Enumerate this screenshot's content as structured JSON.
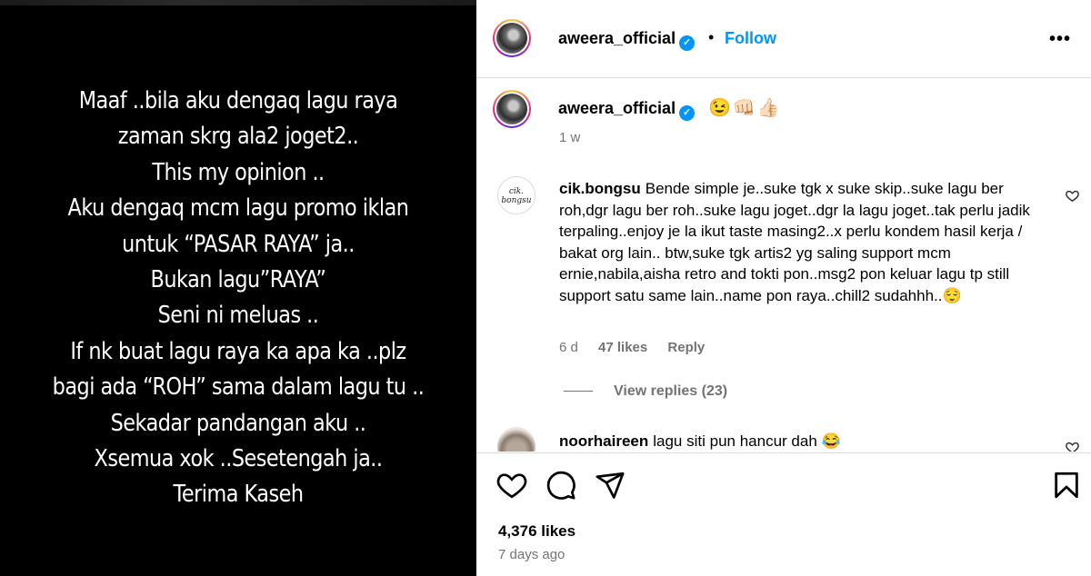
{
  "story": {
    "lines": [
      "Maaf ..bila aku dengaq lagu raya",
      "zaman skrg ala2 joget2..",
      "This my opinion ..",
      "Aku dengaq mcm lagu promo iklan",
      "untuk “PASAR RAYA” ja..",
      "Bukan lagu”RAYA”",
      "Seni ni meluas ..",
      "If nk buat lagu raya ka apa ka ..plz",
      "bagi ada “ROH” sama dalam lagu tu ..",
      "Sekadar pandangan aku ..",
      "Xsemua xok ..Sesetengah ja..",
      "Terima Kaseh"
    ]
  },
  "header": {
    "username": "aweera_official",
    "verified_glyph": "✓",
    "separator": "•",
    "follow_label": "Follow",
    "more_label": "•••"
  },
  "caption": {
    "username": "aweera_official",
    "emojis": "😉👊🏻👍🏻",
    "time": "1 w"
  },
  "comments": [
    {
      "avatar_text": "cik. bongsu",
      "username": "cik.bongsu",
      "text": "Bende simple je..suke tgk x suke skip..suke lagu ber roh,dgr lagu ber roh..suke lagu joget..dgr la lagu joget..tak perlu jadik terpaling..enjoy je la ikut taste masing2..x perlu kondem hasil kerja / bakat org lain.. btw,suke tgk artis2 yg saling support mcm ernie,nabila,aisha retro and tokti pon..msg2 pon keluar lagu tp still support satu same lain..name pon raya..chill2 sudahhh..😌",
      "time": "6 d",
      "likes": "47 likes",
      "reply_label": "Reply",
      "view_replies": "View replies (23)"
    },
    {
      "username": "noorhaireen",
      "text": "lagu siti pun hancur dah 😂"
    }
  ],
  "actions": {
    "likes": "4,376 likes",
    "date": "7 days ago"
  },
  "icons": {
    "like": "heart-icon",
    "comment": "comment-icon",
    "share": "share-icon",
    "save": "bookmark-icon",
    "comment_like": "heart-icon"
  },
  "colors": {
    "link": "#0095f6",
    "secondary_text": "#737373",
    "border": "#dbdbdb"
  }
}
